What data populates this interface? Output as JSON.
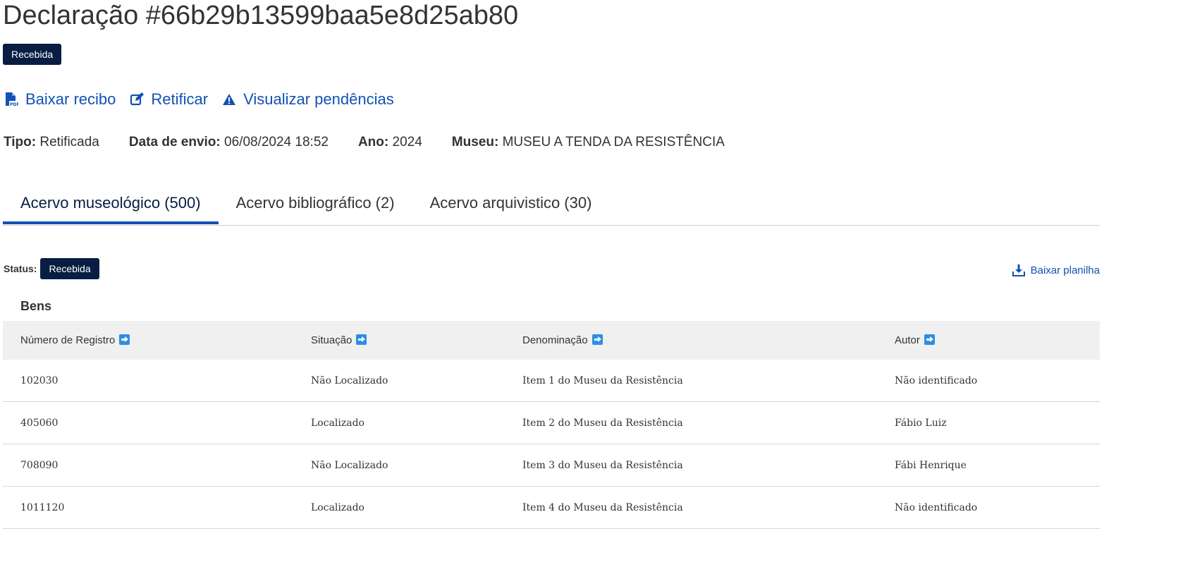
{
  "header": {
    "title": "Declaração #66b29b13599baa5e8d25ab80",
    "status_badge": "Recebida"
  },
  "actions": [
    {
      "label": "Baixar recibo",
      "icon": "pdf-file-icon"
    },
    {
      "label": "Retificar",
      "icon": "edit-icon"
    },
    {
      "label": "Visualizar pendências",
      "icon": "warning-icon"
    }
  ],
  "meta": {
    "tipo_label": "Tipo:",
    "tipo_value": "Retificada",
    "data_label": "Data de envio:",
    "data_value": "06/08/2024 18:52",
    "ano_label": "Ano:",
    "ano_value": "2024",
    "museu_label": "Museu:",
    "museu_value": "MUSEU A TENDA DA RESISTÊNCIA"
  },
  "tabs": [
    {
      "label": "Acervo museológico (500)",
      "active": true
    },
    {
      "label": "Acervo bibliográfico (2)",
      "active": false
    },
    {
      "label": "Acervo arquivistico (30)",
      "active": false
    }
  ],
  "status": {
    "label": "Status:",
    "value": "Recebida"
  },
  "download": {
    "label": "Baixar planilha",
    "icon": "download-icon"
  },
  "table": {
    "section_title": "Bens",
    "columns": [
      "Número de Registro",
      "Situação",
      "Denominação",
      "Autor"
    ],
    "rows": [
      [
        "102030",
        "Não Localizado",
        "Item 1 do Museu da Resistência",
        "Não identificado"
      ],
      [
        "405060",
        "Localizado",
        "Item 2 do Museu da Resistência",
        "Fábio Luiz"
      ],
      [
        "708090",
        "Não Localizado",
        "Item 3 do Museu da Resistência",
        "Fábi Henrique"
      ],
      [
        "1011120",
        "Localizado",
        "Item 4 do Museu da Resistência",
        "Não identificado"
      ]
    ]
  },
  "colors": {
    "primary": "#1351b4",
    "badge": "#071d41",
    "header_bg": "#f0f0f0",
    "sort_icon": "#2b8ee4"
  }
}
